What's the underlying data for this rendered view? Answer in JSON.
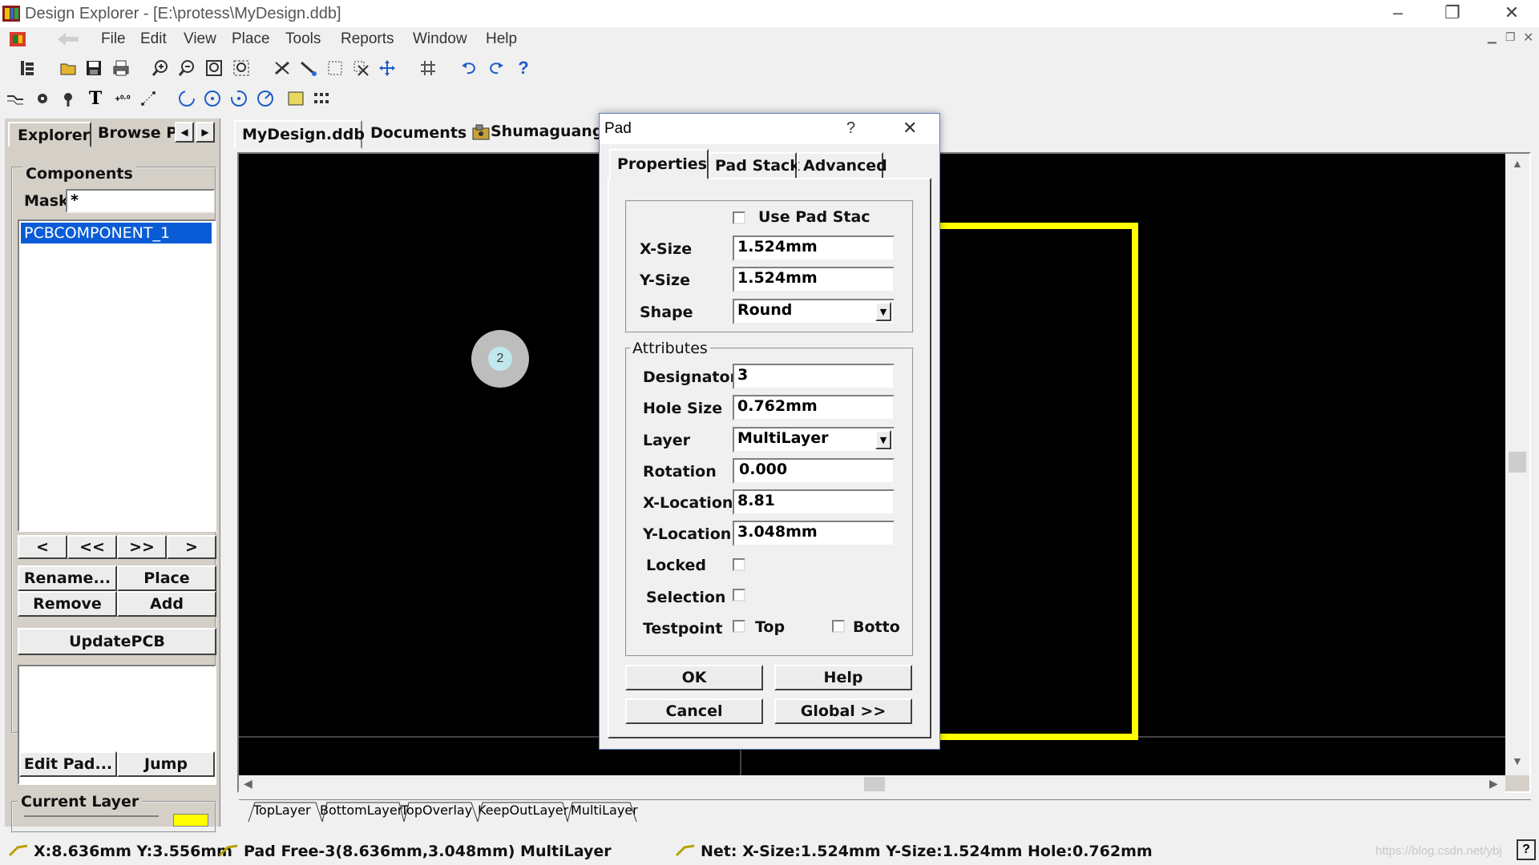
{
  "window": {
    "title": "Design Explorer - [E:\\protess\\MyDesign.ddb]",
    "minimize": "–",
    "restore": "❐",
    "close": "✕"
  },
  "menu": [
    "File",
    "Edit",
    "View",
    "Place",
    "Tools",
    "Reports",
    "Window",
    "Help"
  ],
  "left_panel": {
    "tabs": [
      "Explorer",
      "Browse P"
    ],
    "group_title": "Components",
    "mask_label": "Mask",
    "mask_value": "*",
    "selected_component": "PCBCOMPONENT_1",
    "nav_buttons": [
      "<",
      "<<",
      ">>",
      ">"
    ],
    "rename": "Rename...",
    "place": "Place",
    "remove": "Remove",
    "add": "Add",
    "update_pcb": "UpdatePCB",
    "edit_pad": "Edit Pad...",
    "jump": "Jump",
    "current_layer": "Current Layer"
  },
  "doc_tabs": [
    "MyDesign.ddb",
    "Documents",
    "Shumaguang"
  ],
  "canvas": {
    "pad_designator": "2",
    "outline_color": "#ffff00",
    "background": "#000000"
  },
  "layer_tabs": [
    "TopLayer",
    "BottomLayer",
    "TopOverlay",
    "KeepOutLayer",
    "MultiLayer"
  ],
  "status": {
    "coords": "X:8.636mm Y:3.556mm",
    "pad_info": "Pad Free-3(8.636mm,3.048mm)  MultiLayer",
    "net_info": "Net: X-Size:1.524mm Y-Size:1.524mm Hole:0.762mm",
    "watermark": "https://blog.csdn.net/ybj"
  },
  "dialog": {
    "title": "Pad",
    "help": "?",
    "close": "✕",
    "tabs": [
      "Properties",
      "Pad Stack",
      "Advanced"
    ],
    "use_pad_stack": "Use Pad Stac",
    "x_size_label": "X-Size",
    "x_size": "1.524mm",
    "y_size_label": "Y-Size",
    "y_size": "1.524mm",
    "shape_label": "Shape",
    "shape": "Round",
    "attributes_title": "Attributes",
    "designator_label": "Designator",
    "designator": "3",
    "hole_size_label": "Hole Size",
    "hole_size": "0.762mm",
    "layer_label": "Layer",
    "layer": "MultiLayer",
    "rotation_label": "Rotation",
    "rotation": "0.000",
    "x_location_label": "X-Location",
    "x_location": "8.81",
    "y_location_label": "Y-Location",
    "y_location": "3.048mm",
    "locked_label": "Locked",
    "selection_label": "Selection",
    "testpoint_label": "Testpoint",
    "top_label": "Top",
    "bottom_label": "Botto",
    "ok": "OK",
    "help_button": "Help",
    "cancel": "Cancel",
    "global": "Global >>"
  }
}
